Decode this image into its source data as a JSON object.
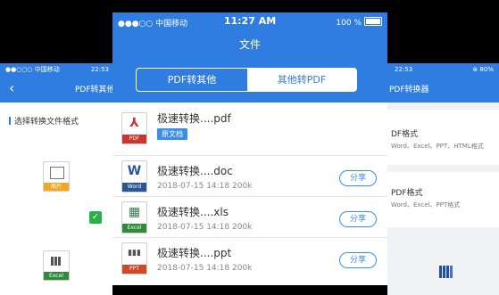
{
  "left_phone": {
    "status_left": "●●○○○ 中国移动",
    "status_right": "22:53",
    "nav_title": "PDF转其他",
    "section_label": "选择转换文件格式",
    "icons": [
      {
        "label": "图片",
        "color": "#f5a623"
      },
      {
        "label": "Excel",
        "color": "#2e8b3a"
      }
    ],
    "check_glyph": "✓"
  },
  "main_phone": {
    "status": {
      "carrier": "●●●○○ 中国移动",
      "time": "11:27 AM",
      "battery": "100 %"
    },
    "header_title": "文件",
    "segment": {
      "active": "PDF转其他",
      "inactive": "其他转PDF"
    },
    "files": [
      {
        "name": "极速转换....pdf",
        "tag": "原文档",
        "icon_label": "PDF",
        "icon_glyph": "⅄",
        "icon_color": "#d0332c"
      },
      {
        "name": "极速转换....doc",
        "date": "2018-07-15",
        "time": "14:18",
        "size": "200k",
        "icon_label": "Word",
        "icon_glyph": "W",
        "icon_color": "#2a5699",
        "share": "分享"
      },
      {
        "name": "极速转换....xls",
        "date": "2018-07-15",
        "time": "14:18",
        "size": "200k",
        "icon_label": "Excel",
        "icon_glyph": "▦",
        "icon_color": "#2e8b3a",
        "share": "分享"
      },
      {
        "name": "极速转换....ppt",
        "date": "2018-07-15",
        "time": "14:18",
        "size": "200k",
        "icon_label": "PPT",
        "icon_glyph": "▮▮▮",
        "icon_color": "#d24726",
        "share": "分享"
      }
    ]
  },
  "right_phone": {
    "status_left": "22:53",
    "status_right": "⊛ 80%",
    "nav_title": "PDF转换器",
    "cards": [
      {
        "title": "DF格式",
        "desc": "Word、Excel、PPT、HTML格式"
      },
      {
        "title": "PDF格式",
        "desc": "Word、Excel、PPT格式"
      }
    ]
  }
}
